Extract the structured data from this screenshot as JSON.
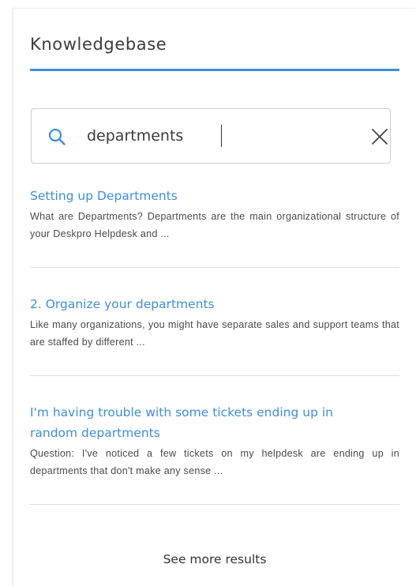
{
  "header": {
    "title": "Knowledgebase"
  },
  "search": {
    "value": "departments",
    "icon": "search-icon",
    "clear_icon": "close-icon"
  },
  "results": [
    {
      "title": "Setting up Departments",
      "snippet": "What are Departments? Departments are the main organizational structure of your Deskpro Helpdesk and ..."
    },
    {
      "title": "2. Organize your departments",
      "snippet": "Like many organizations, you might have separate sales and support teams that are staffed by different ..."
    },
    {
      "title": "I'm having trouble with some tickets ending up in random departments",
      "snippet": "Question: I've noticed a few tickets on my helpdesk are ending up in departments that don't make any sense ..."
    }
  ],
  "footer": {
    "see_more_label": "See more results"
  },
  "colors": {
    "accent": "#3d8ee0",
    "text": "#333333",
    "border": "#c9ced4"
  }
}
